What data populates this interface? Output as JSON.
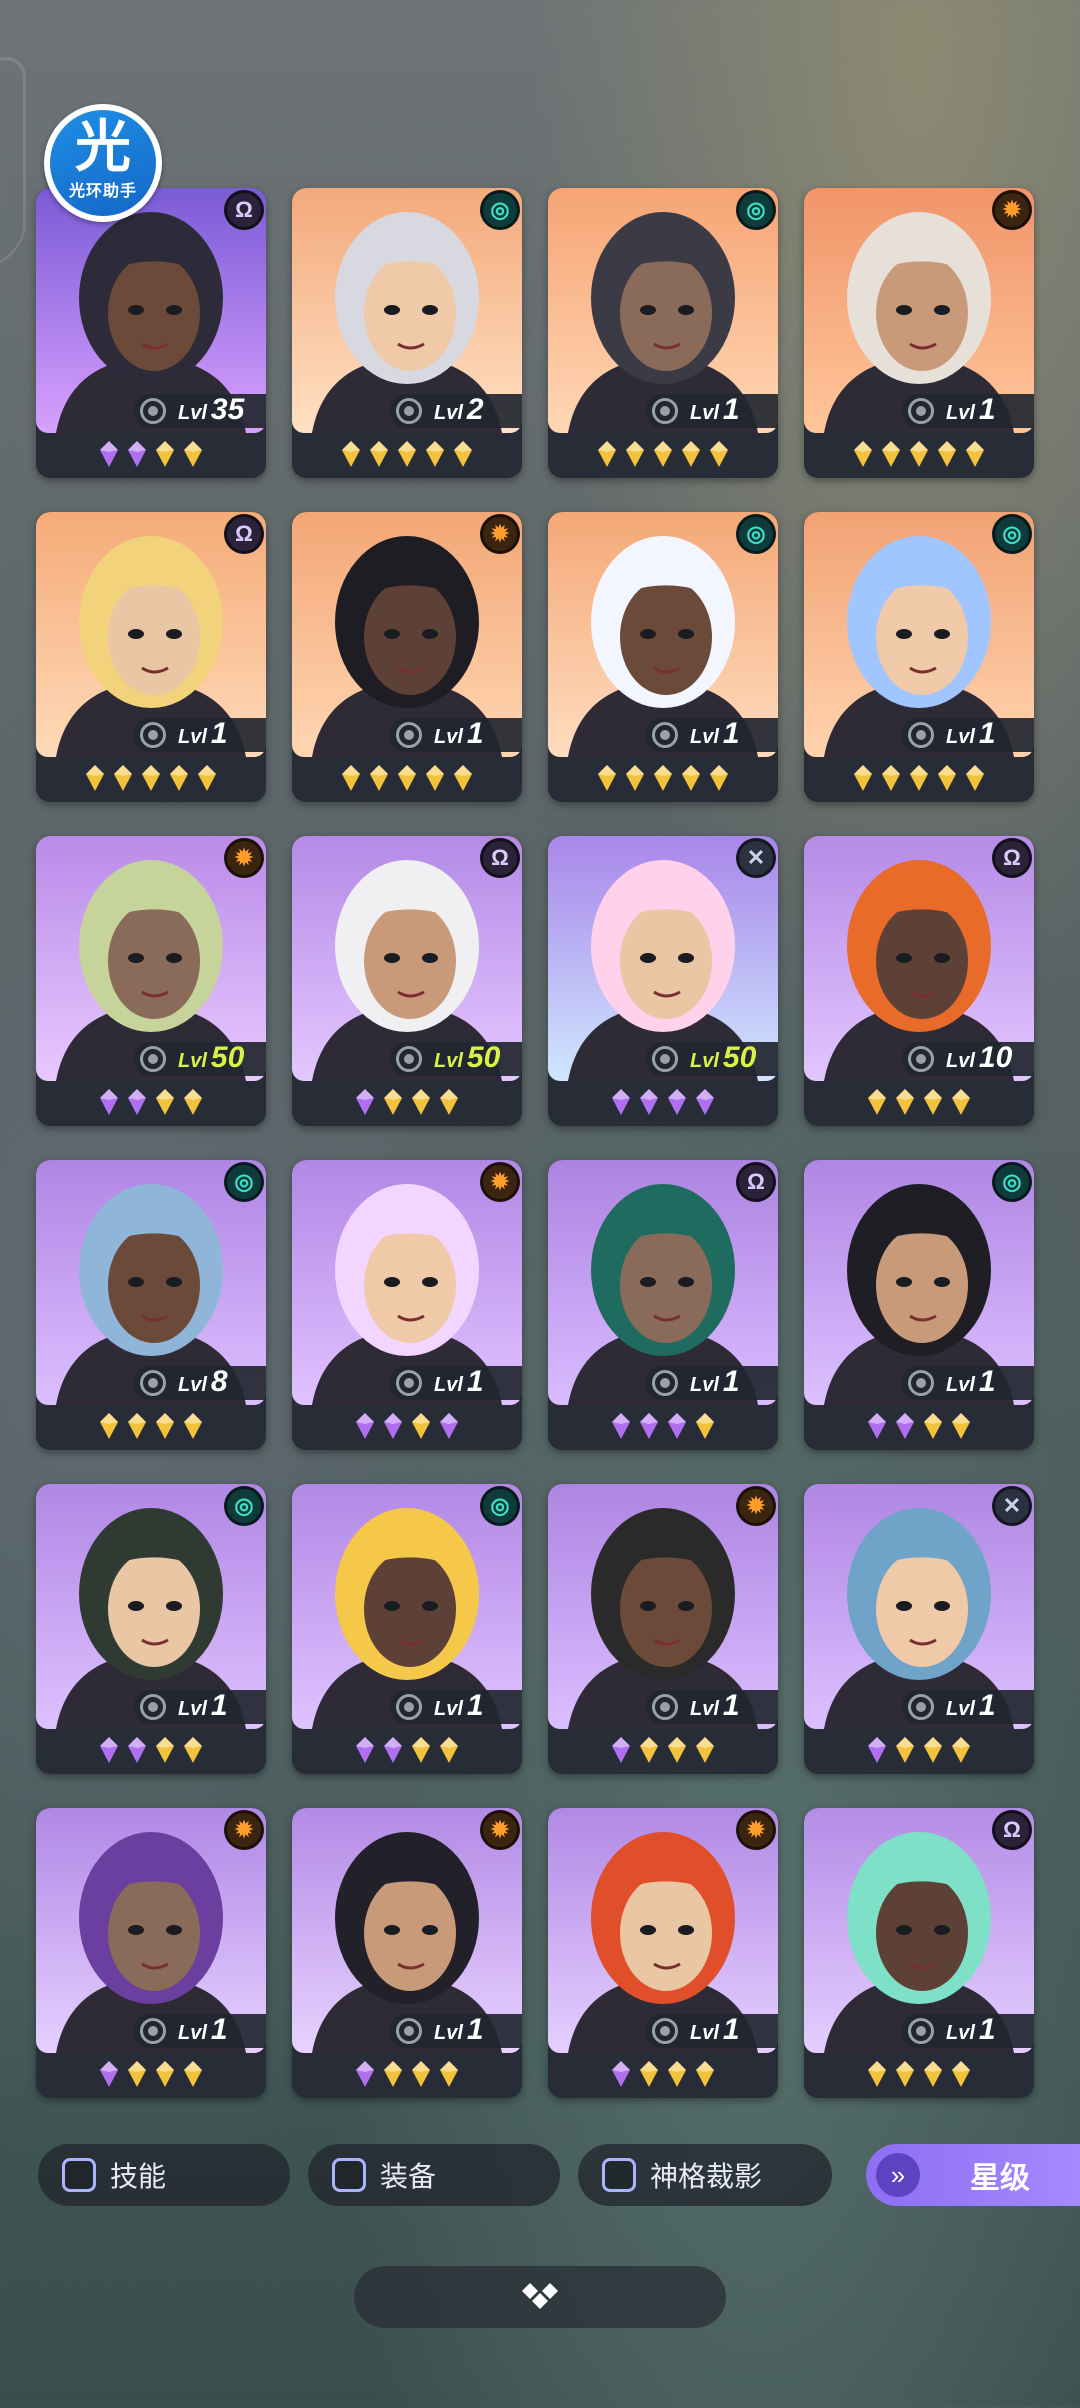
{
  "app": {
    "logo_glyph": "光",
    "logo_text": "光环助手"
  },
  "cards": [
    {
      "type": "purple",
      "type_icon": "rune-icon",
      "lvl_prefix": "Lvl",
      "level": "35",
      "level_high": false,
      "gems": [
        "purple",
        "purple",
        "gold",
        "gold"
      ],
      "bg": [
        "#7a5bd6",
        "#d8a0ff"
      ]
    },
    {
      "type": "teal",
      "type_icon": "swirl-icon",
      "lvl_prefix": "Lvl",
      "level": "2",
      "level_high": false,
      "gems": [
        "gold",
        "gold",
        "gold",
        "gold",
        "gold"
      ],
      "bg": [
        "#f3a97a",
        "#ffe0c4"
      ]
    },
    {
      "type": "teal",
      "type_icon": "swirl-icon",
      "lvl_prefix": "Lvl",
      "level": "1",
      "level_high": false,
      "gems": [
        "gold",
        "gold",
        "gold",
        "gold",
        "gold"
      ],
      "bg": [
        "#f6a474",
        "#ffd7b5"
      ]
    },
    {
      "type": "orange",
      "type_icon": "sun-icon",
      "lvl_prefix": "Lvl",
      "level": "1",
      "level_high": false,
      "gems": [
        "gold",
        "gold",
        "gold",
        "gold",
        "gold"
      ],
      "bg": [
        "#f1946a",
        "#ffc69a"
      ]
    },
    {
      "type": "purple",
      "type_icon": "rune-icon",
      "lvl_prefix": "Lvl",
      "level": "1",
      "level_high": false,
      "gems": [
        "gold",
        "gold",
        "gold",
        "gold",
        "gold"
      ],
      "bg": [
        "#f5ab78",
        "#ffd9b8"
      ]
    },
    {
      "type": "orange",
      "type_icon": "sun-icon",
      "lvl_prefix": "Lvl",
      "level": "1",
      "level_high": false,
      "gems": [
        "gold",
        "gold",
        "gold",
        "gold",
        "gold"
      ],
      "bg": [
        "#f3a676",
        "#ffd6b2"
      ]
    },
    {
      "type": "teal",
      "type_icon": "swirl-icon",
      "lvl_prefix": "Lvl",
      "level": "1",
      "level_high": false,
      "gems": [
        "gold",
        "gold",
        "gold",
        "gold",
        "gold"
      ],
      "bg": [
        "#f4a877",
        "#ffdcbf"
      ]
    },
    {
      "type": "teal",
      "type_icon": "swirl-icon",
      "lvl_prefix": "Lvl",
      "level": "1",
      "level_high": false,
      "gems": [
        "gold",
        "gold",
        "gold",
        "gold",
        "gold"
      ],
      "bg": [
        "#f2a274",
        "#ffd3ae"
      ]
    },
    {
      "type": "orange",
      "type_icon": "sun-icon",
      "lvl_prefix": "Lvl",
      "level": "50",
      "level_high": true,
      "gems": [
        "purple",
        "purple",
        "gold",
        "gold"
      ],
      "bg": [
        "#b98be8",
        "#e8c8ff"
      ]
    },
    {
      "type": "purple",
      "type_icon": "rune-icon",
      "lvl_prefix": "Lvl",
      "level": "50",
      "level_high": true,
      "gems": [
        "purple",
        "gold",
        "gold",
        "gold"
      ],
      "bg": [
        "#b48ae6",
        "#e4c7ff"
      ]
    },
    {
      "type": "gray",
      "type_icon": "cross-icon",
      "lvl_prefix": "Lvl",
      "level": "50",
      "level_high": true,
      "gems": [
        "purple",
        "purple",
        "purple",
        "purple"
      ],
      "bg": [
        "#a886ea",
        "#cfe6ff"
      ]
    },
    {
      "type": "purple",
      "type_icon": "rune-icon",
      "lvl_prefix": "Lvl",
      "level": "10",
      "level_high": false,
      "gems": [
        "gold",
        "gold",
        "gold",
        "gold"
      ],
      "bg": [
        "#b58be6",
        "#e2c5ff"
      ]
    },
    {
      "type": "teal",
      "type_icon": "swirl-icon",
      "lvl_prefix": "Lvl",
      "level": "8",
      "level_high": false,
      "gems": [
        "gold",
        "gold",
        "gold",
        "gold"
      ],
      "bg": [
        "#b085e4",
        "#dcbfff"
      ]
    },
    {
      "type": "orange",
      "type_icon": "sun-icon",
      "lvl_prefix": "Lvl",
      "level": "1",
      "level_high": false,
      "gems": [
        "purple",
        "purple",
        "gold",
        "purple"
      ],
      "bg": [
        "#b287e6",
        "#e0c2ff"
      ]
    },
    {
      "type": "purple",
      "type_icon": "rune-icon",
      "lvl_prefix": "Lvl",
      "level": "1",
      "level_high": false,
      "gems": [
        "purple",
        "purple",
        "purple",
        "gold"
      ],
      "bg": [
        "#ad83e2",
        "#d9bcff"
      ]
    },
    {
      "type": "teal",
      "type_icon": "swirl-icon",
      "lvl_prefix": "Lvl",
      "level": "1",
      "level_high": false,
      "gems": [
        "purple",
        "purple",
        "gold",
        "gold"
      ],
      "bg": [
        "#b086e4",
        "#dcc0ff"
      ]
    },
    {
      "type": "teal",
      "type_icon": "swirl-icon",
      "lvl_prefix": "Lvl",
      "level": "1",
      "level_high": false,
      "gems": [
        "purple",
        "purple",
        "gold",
        "gold"
      ],
      "bg": [
        "#b187e5",
        "#dec1ff"
      ]
    },
    {
      "type": "teal",
      "type_icon": "swirl-icon",
      "lvl_prefix": "Lvl",
      "level": "1",
      "level_high": false,
      "gems": [
        "purple",
        "purple",
        "gold",
        "gold"
      ],
      "bg": [
        "#b288e6",
        "#dfc2ff"
      ]
    },
    {
      "type": "orange",
      "type_icon": "sun-icon",
      "lvl_prefix": "Lvl",
      "level": "1",
      "level_high": false,
      "gems": [
        "purple",
        "gold",
        "gold",
        "gold"
      ],
      "bg": [
        "#ae85e3",
        "#dbbeff"
      ]
    },
    {
      "type": "gray",
      "type_icon": "cross-icon",
      "lvl_prefix": "Lvl",
      "level": "1",
      "level_high": false,
      "gems": [
        "purple",
        "gold",
        "gold",
        "gold"
      ],
      "bg": [
        "#b086e4",
        "#dcc0ff"
      ]
    },
    {
      "type": "orange",
      "type_icon": "sun-icon",
      "lvl_prefix": "Lvl",
      "level": "1",
      "level_high": false,
      "gems": [
        "purple",
        "gold",
        "gold",
        "gold"
      ],
      "bg": [
        "#b088e6",
        "#e6d0ff"
      ]
    },
    {
      "type": "orange",
      "type_icon": "sun-icon",
      "lvl_prefix": "Lvl",
      "level": "1",
      "level_high": false,
      "gems": [
        "purple",
        "gold",
        "gold",
        "gold"
      ],
      "bg": [
        "#b38ae6",
        "#e8d2ff"
      ]
    },
    {
      "type": "orange",
      "type_icon": "sun-icon",
      "lvl_prefix": "Lvl",
      "level": "1",
      "level_high": false,
      "gems": [
        "purple",
        "gold",
        "gold",
        "gold"
      ],
      "bg": [
        "#b189e5",
        "#e5cfff"
      ]
    },
    {
      "type": "purple",
      "type_icon": "rune-icon",
      "lvl_prefix": "Lvl",
      "level": "1",
      "level_high": false,
      "gems": [
        "gold",
        "gold",
        "gold",
        "gold"
      ],
      "bg": [
        "#b48ce6",
        "#e4ceff"
      ]
    }
  ],
  "filters": {
    "skill": "技能",
    "equipment": "装备",
    "divine": "神格裁影",
    "star": "星级",
    "star_icon": "chevron-double-down-icon"
  },
  "bottom": {
    "icon": "diamond-cluster-icon"
  },
  "colors": {
    "gold_gem": "#f2c23a",
    "purple_gem": "#b06ef0",
    "level_high": "#d9f14a"
  }
}
